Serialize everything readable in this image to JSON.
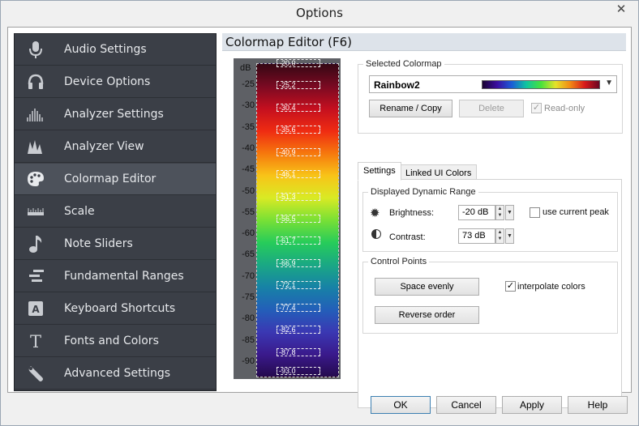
{
  "window": {
    "title": "Options",
    "close_glyph": "✕"
  },
  "sidebar": {
    "items": [
      {
        "label": "Audio Settings",
        "icon": "microphone-icon"
      },
      {
        "label": "Device Options",
        "icon": "headphones-icon"
      },
      {
        "label": "Analyzer Settings",
        "icon": "analyzer-settings-icon"
      },
      {
        "label": "Analyzer View",
        "icon": "analyzer-view-icon"
      },
      {
        "label": "Colormap Editor",
        "icon": "palette-icon",
        "active": true
      },
      {
        "label": "Scale",
        "icon": "ruler-icon"
      },
      {
        "label": "Note Sliders",
        "icon": "music-note-icon"
      },
      {
        "label": "Fundamental Ranges",
        "icon": "ranges-icon"
      },
      {
        "label": "Keyboard Shortcuts",
        "icon": "keyboard-key-icon"
      },
      {
        "label": "Fonts and Colors",
        "icon": "font-icon"
      },
      {
        "label": "Advanced Settings",
        "icon": "wrench-icon"
      }
    ]
  },
  "panel": {
    "title": "Colormap Editor (F6)"
  },
  "colormap": {
    "db_header": "dB",
    "db_ticks": [
      "-25",
      "-30",
      "-35",
      "-40",
      "-45",
      "-50",
      "-55",
      "-60",
      "-65",
      "-70",
      "-75",
      "-80",
      "-85",
      "-90"
    ],
    "control_points": [
      "-20.0",
      "-25.2",
      "-30.4",
      "-35.6",
      "-40.9",
      "-46.1",
      "-51.3",
      "-56.5",
      "-61.7",
      "-66.9",
      "-72.1",
      "-77.4",
      "-82.6",
      "-87.8",
      "-93.0"
    ],
    "gradient_colors": [
      "#350814",
      "#7a0a22",
      "#c40f1f",
      "#ef2b12",
      "#f6780d",
      "#f8c418",
      "#d9ea24",
      "#78e035",
      "#27cc5a",
      "#1aa884",
      "#1782a6",
      "#235fb9",
      "#3a38b3",
      "#3a1a8c",
      "#250a4e"
    ]
  },
  "selected_colormap": {
    "group_title": "Selected Colormap",
    "name": "Rainbow2",
    "rename_label": "Rename / Copy",
    "delete_label": "Delete",
    "readonly_label": "Read-only",
    "readonly_checked": true
  },
  "tabs": {
    "settings": "Settings",
    "linked": "Linked UI Colors"
  },
  "dynamic_range": {
    "group_title": "Displayed Dynamic Range",
    "brightness_label": "Brightness:",
    "brightness_value": "-20 dB",
    "use_current_peak_label": "use current peak",
    "use_current_peak_checked": false,
    "contrast_label": "Contrast:",
    "contrast_value": "73 dB"
  },
  "control_points": {
    "group_title": "Control Points",
    "space_evenly_label": "Space evenly",
    "reverse_order_label": "Reverse order",
    "interpolate_label": "interpolate colors",
    "interpolate_checked": true
  },
  "footer": {
    "ok": "OK",
    "cancel": "Cancel",
    "apply": "Apply",
    "help": "Help"
  }
}
